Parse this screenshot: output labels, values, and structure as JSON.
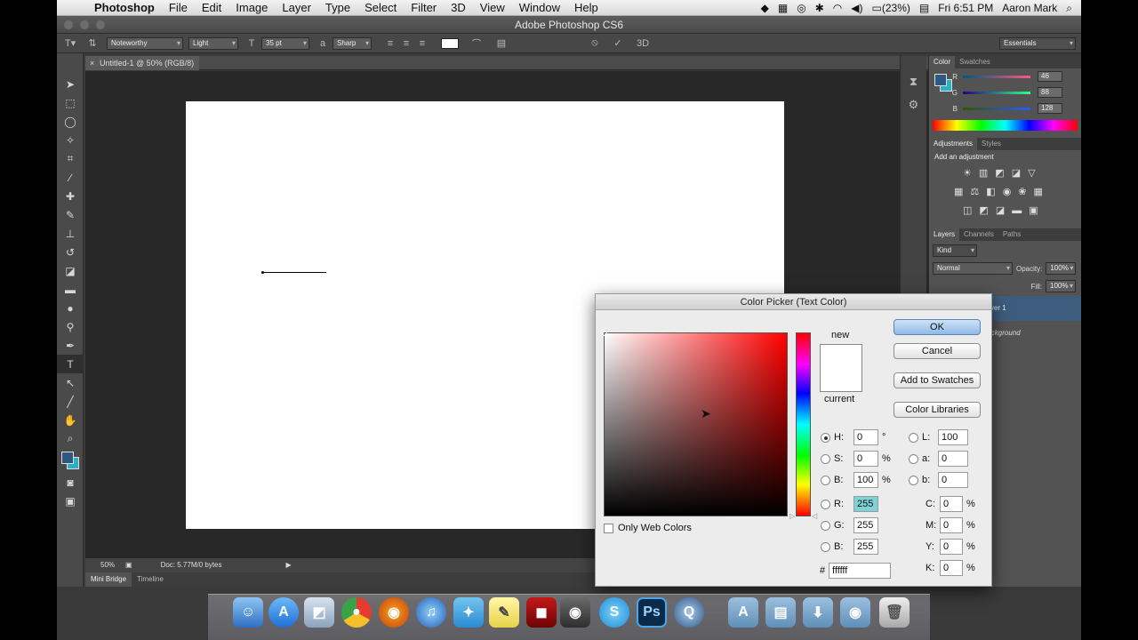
{
  "menubar": {
    "app_name": "Photoshop",
    "items": [
      "File",
      "Edit",
      "Image",
      "Layer",
      "Type",
      "Select",
      "Filter",
      "3D",
      "View",
      "Window",
      "Help"
    ],
    "status": {
      "battery": "(23%)",
      "clock": "Fri 6:51 PM",
      "user": "Aaron Mark"
    }
  },
  "window": {
    "title": "Adobe Photoshop CS6"
  },
  "options_bar": {
    "font_family": "Noteworthy",
    "font_style": "Light",
    "font_size": "35 pt",
    "antialias": "Sharp",
    "workspace": "Essentials",
    "text_color": "#ffffff"
  },
  "document": {
    "tab_title": "Untitled-1 @ 50% (RGB/8)",
    "zoom": "50%",
    "doc_info": "Doc: 5.77M/0 bytes",
    "bottom_tabs": [
      "Mini Bridge",
      "Timeline"
    ]
  },
  "panels": {
    "color": {
      "tabs": [
        "Color",
        "Swatches"
      ],
      "channels": [
        {
          "label": "R",
          "value": "46"
        },
        {
          "label": "G",
          "value": "88"
        },
        {
          "label": "B",
          "value": "128"
        }
      ],
      "fg_color": "#2e5880",
      "bg_color": "#2bb0c8"
    },
    "adjustments": {
      "tabs": [
        "Adjustments",
        "Styles"
      ],
      "heading": "Add an adjustment"
    },
    "layers": {
      "tabs": [
        "Layers",
        "Channels",
        "Paths"
      ],
      "kind": "Kind",
      "blend_mode": "Normal",
      "opacity_label": "Opacity:",
      "opacity": "100%",
      "fill_label": "Fill:",
      "fill": "100%",
      "layer1": "Layer 1",
      "background": "Background"
    }
  },
  "color_picker": {
    "title": "Color Picker (Text Color)",
    "buttons": {
      "ok": "OK",
      "cancel": "Cancel",
      "add_swatches": "Add to Swatches",
      "libraries": "Color Libraries"
    },
    "new_label": "new",
    "current_label": "current",
    "new_color": "#ffffff",
    "current_color": "#ffffff",
    "only_web_colors": "Only Web Colors",
    "fields": {
      "H": {
        "label": "H:",
        "value": "0",
        "unit": "°"
      },
      "S": {
        "label": "S:",
        "value": "0",
        "unit": "%"
      },
      "B": {
        "label": "B:",
        "value": "100",
        "unit": "%"
      },
      "R": {
        "label": "R:",
        "value": "255"
      },
      "G": {
        "label": "G:",
        "value": "255"
      },
      "Bl": {
        "label": "B:",
        "value": "255"
      },
      "L": {
        "label": "L:",
        "value": "100"
      },
      "a": {
        "label": "a:",
        "value": "0"
      },
      "b": {
        "label": "b:",
        "value": "0"
      },
      "C": {
        "label": "C:",
        "value": "0",
        "unit": "%"
      },
      "M": {
        "label": "M:",
        "value": "0",
        "unit": "%"
      },
      "Y": {
        "label": "Y:",
        "value": "0",
        "unit": "%"
      },
      "K": {
        "label": "K:",
        "value": "0",
        "unit": "%"
      },
      "hex": {
        "label": "#",
        "value": "ffffff"
      }
    }
  },
  "dock": {
    "apps": [
      "finder",
      "app-store",
      "preview",
      "chrome",
      "firefox",
      "itunes",
      "twitter",
      "stickies",
      "photo-booth",
      "facetime",
      "skype",
      "photoshop",
      "quicktime",
      "applications-folder",
      "documents-folder",
      "downloads-folder",
      "folder",
      "trash"
    ],
    "ps_label": "Ps"
  }
}
